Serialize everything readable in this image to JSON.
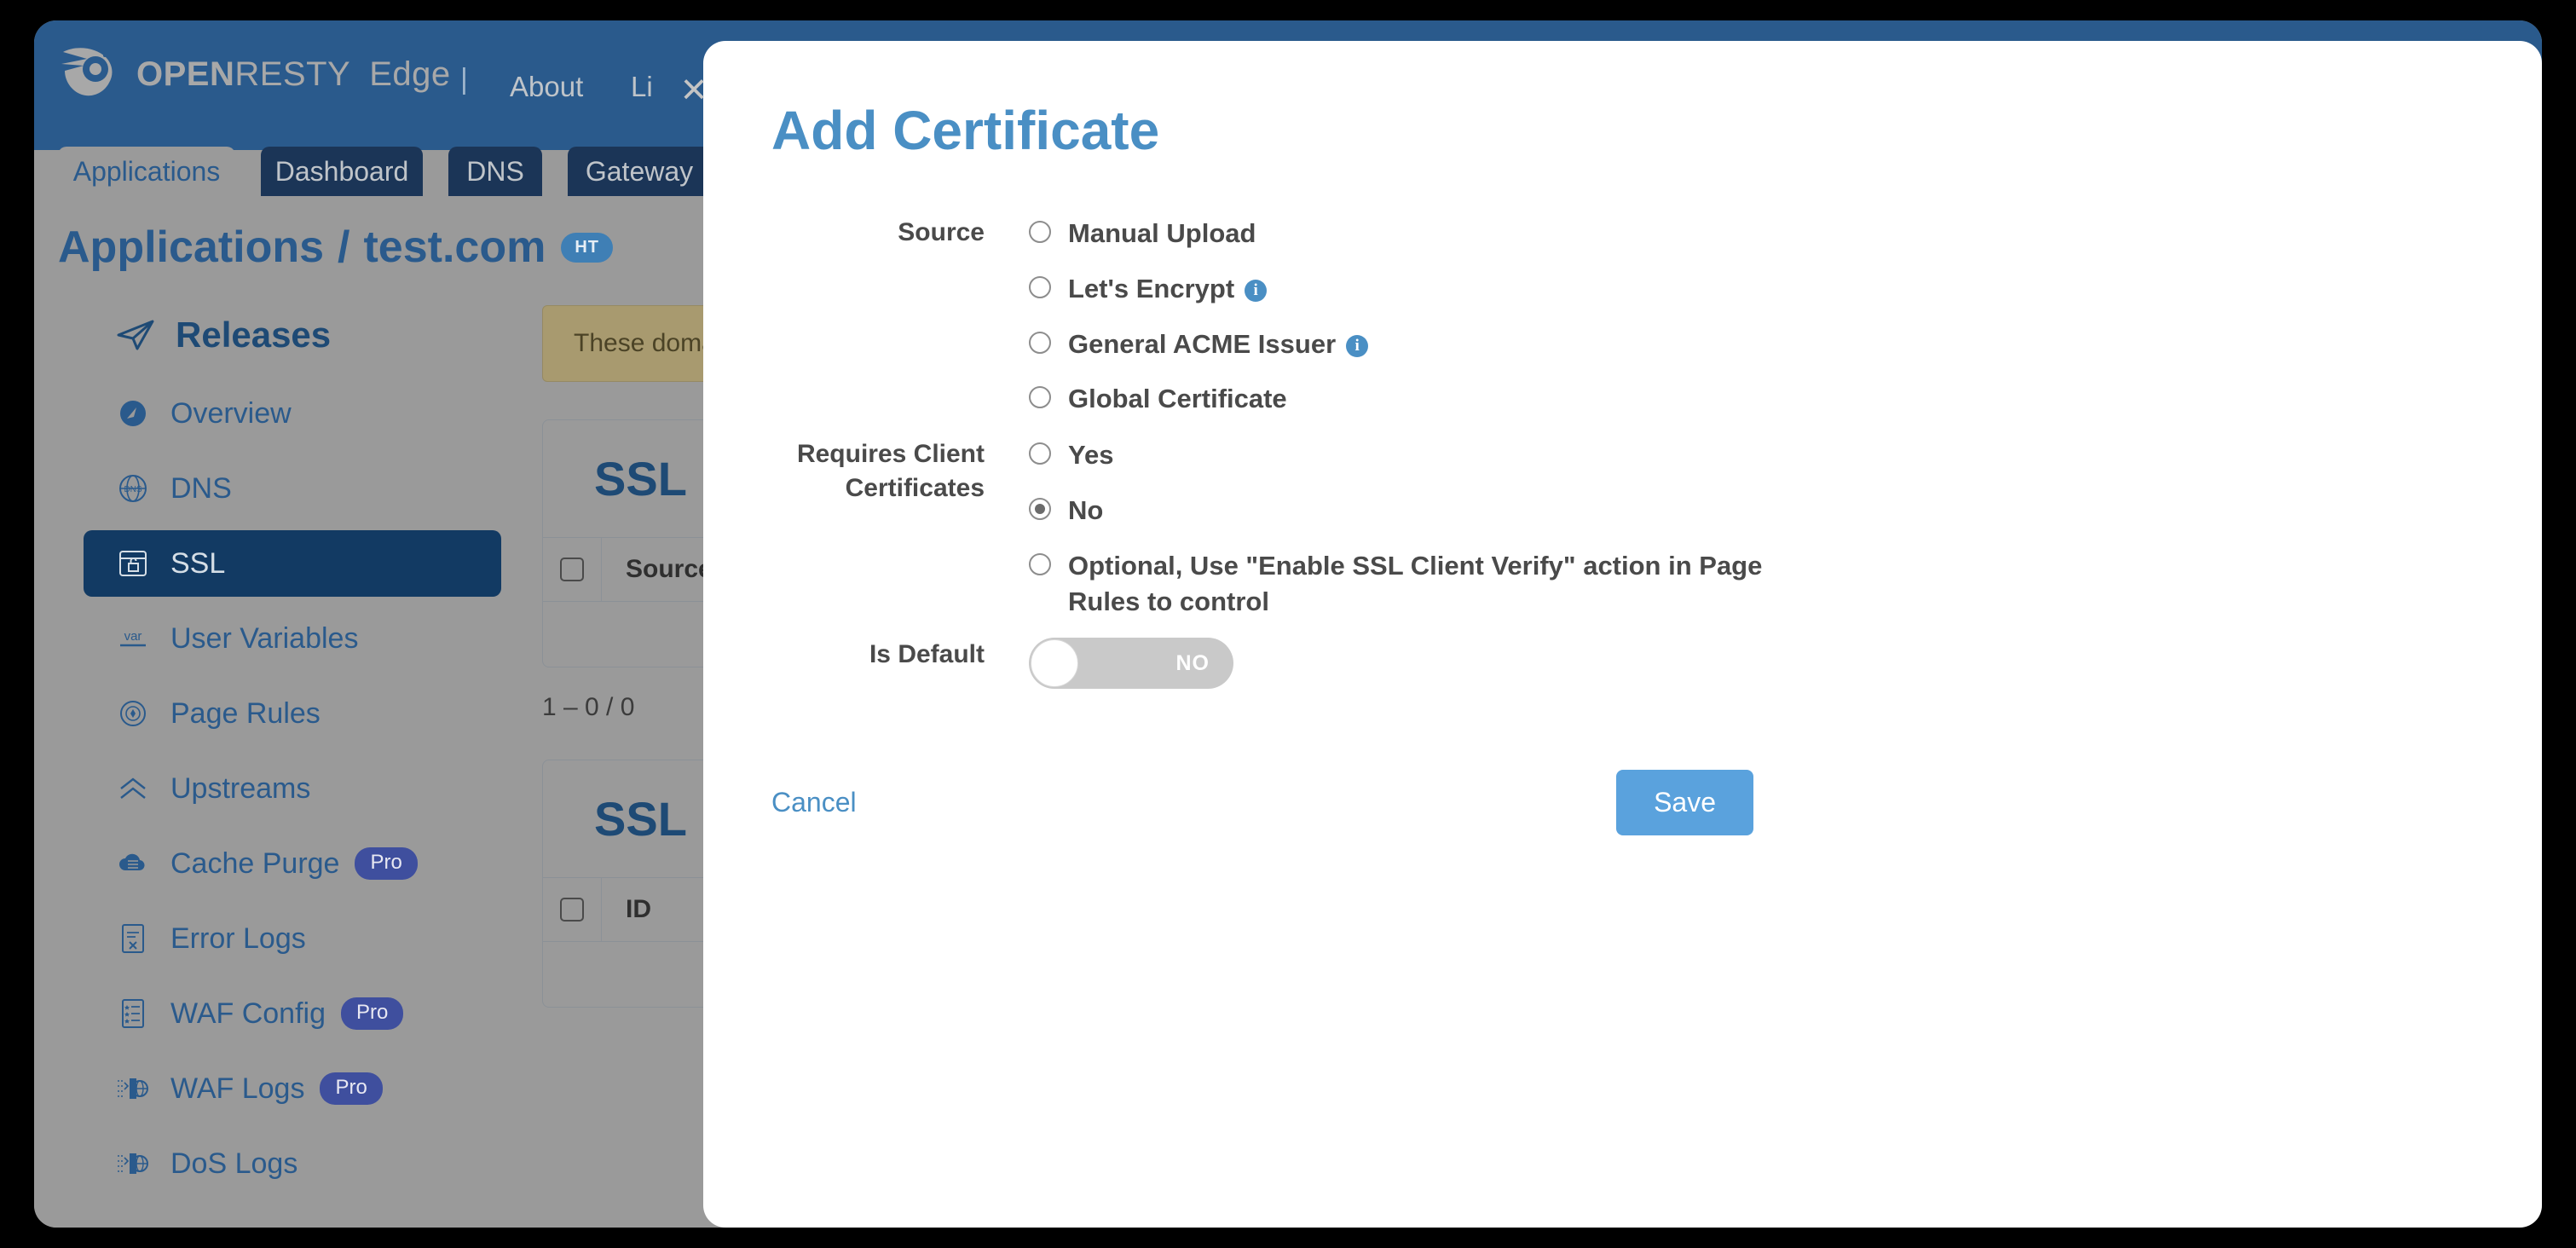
{
  "header": {
    "brand_open": "OPEN",
    "brand_resty": "RESTY",
    "brand_edge": "Edge",
    "separator": "|",
    "nav": [
      {
        "label": "About"
      },
      {
        "label": "Li"
      }
    ]
  },
  "tabs": [
    {
      "label": "Applications",
      "active": true
    },
    {
      "label": "Dashboard",
      "active": false
    },
    {
      "label": "DNS",
      "active": false
    },
    {
      "label": "Gateway",
      "active": false
    }
  ],
  "breadcrumb": {
    "root": "Applications",
    "separator": "/",
    "current": "test.com",
    "badge": "HT"
  },
  "sidebar": {
    "heading": "Releases",
    "items": [
      {
        "label": "Overview",
        "icon": "gauge-icon",
        "active": false,
        "pro": ""
      },
      {
        "label": "DNS",
        "icon": "globe-dns-icon",
        "active": false,
        "pro": ""
      },
      {
        "label": "SSL",
        "icon": "browser-lock-icon",
        "active": true,
        "pro": ""
      },
      {
        "label": "User Variables",
        "icon": "var-icon",
        "active": false,
        "pro": ""
      },
      {
        "label": "Page Rules",
        "icon": "page-rules-icon",
        "active": false,
        "pro": ""
      },
      {
        "label": "Upstreams",
        "icon": "chevrons-up-icon",
        "active": false,
        "pro": ""
      },
      {
        "label": "Cache Purge",
        "icon": "cloud-database-icon",
        "active": false,
        "pro": "Pro"
      },
      {
        "label": "Error Logs",
        "icon": "document-x-icon",
        "active": false,
        "pro": ""
      },
      {
        "label": "WAF Config",
        "icon": "list-star-icon",
        "active": false,
        "pro": "Pro"
      },
      {
        "label": "WAF Logs",
        "icon": "firewall-globe-icon",
        "active": false,
        "pro": "Pro"
      },
      {
        "label": "DoS Logs",
        "icon": "firewall-globe-icon",
        "active": false,
        "pro": ""
      }
    ]
  },
  "main": {
    "alert": "These domai",
    "cards": [
      {
        "title": "SSL",
        "columns": [
          "Source"
        ],
        "pager": "1 – 0 / 0"
      },
      {
        "title": "SSL",
        "columns": [
          "ID"
        ],
        "pager": ""
      }
    ]
  },
  "modal": {
    "title": "Add Certificate",
    "close_icon": "×",
    "source": {
      "label": "Source",
      "options": [
        {
          "label": "Manual Upload",
          "checked": false,
          "info": false
        },
        {
          "label": "Let's Encrypt",
          "checked": false,
          "info": true
        },
        {
          "label": "General ACME Issuer",
          "checked": false,
          "info": true
        },
        {
          "label": "Global Certificate",
          "checked": false,
          "info": false
        }
      ]
    },
    "client_certs": {
      "label": "Requires Client Certificates",
      "options": [
        {
          "label": "Yes",
          "checked": false
        },
        {
          "label": "No",
          "checked": true
        },
        {
          "label": "Optional, Use \"Enable SSL Client Verify\" action in Page Rules to control",
          "checked": false
        }
      ]
    },
    "is_default": {
      "label": "Is Default",
      "value": "NO"
    },
    "cancel_label": "Cancel",
    "save_label": "Save"
  },
  "colors": {
    "header_blue": "#2a5a8c",
    "tab_inactive": "#1b3557",
    "sidebar_active": "#123a63",
    "accent_blue": "#4a8fc4",
    "save_blue": "#5aa2dd",
    "pro_badge": "#3f4f9e",
    "alert_bg": "#a89a6f"
  }
}
